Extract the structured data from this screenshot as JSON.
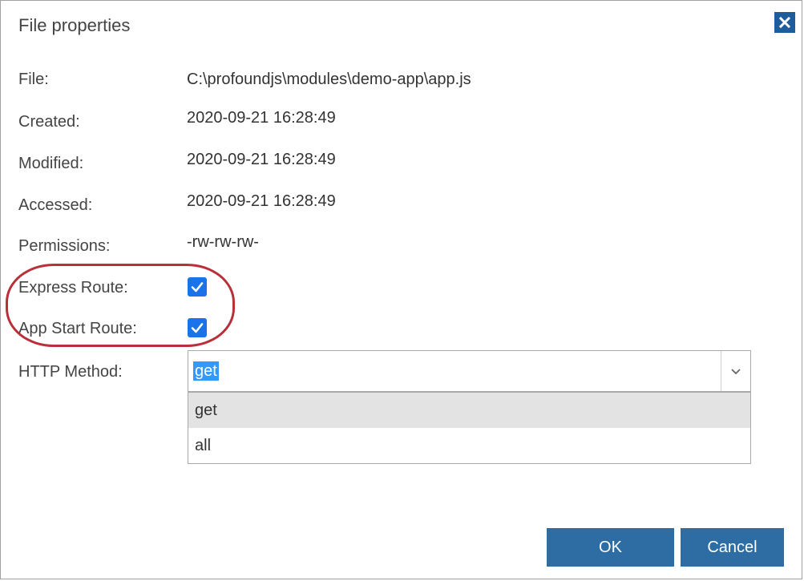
{
  "dialog": {
    "title": "File properties",
    "close_icon": "close-icon"
  },
  "properties": {
    "file_label": "File:",
    "file_value": "C:\\profoundjs\\modules\\demo-app\\app.js",
    "created_label": "Created:",
    "created_value": "2020-09-21 16:28:49",
    "modified_label": "Modified:",
    "modified_value": "2020-09-21 16:28:49",
    "accessed_label": "Accessed:",
    "accessed_value": "2020-09-21 16:28:49",
    "permissions_label": "Permissions:",
    "permissions_value": "-rw-rw-rw-",
    "express_route_label": "Express Route:",
    "express_route_checked": true,
    "app_start_route_label": "App Start Route:",
    "app_start_route_checked": true,
    "http_method_label": "HTTP Method:"
  },
  "http_method": {
    "selected": "get",
    "options": [
      "get",
      "all"
    ],
    "highlighted_index": 0
  },
  "buttons": {
    "ok_label": "OK",
    "cancel_label": "Cancel"
  },
  "colors": {
    "accent": "#2d6da3",
    "checkbox": "#1a73e8",
    "highlight_ring": "#b8303a",
    "close_button": "#1e5c9b"
  }
}
